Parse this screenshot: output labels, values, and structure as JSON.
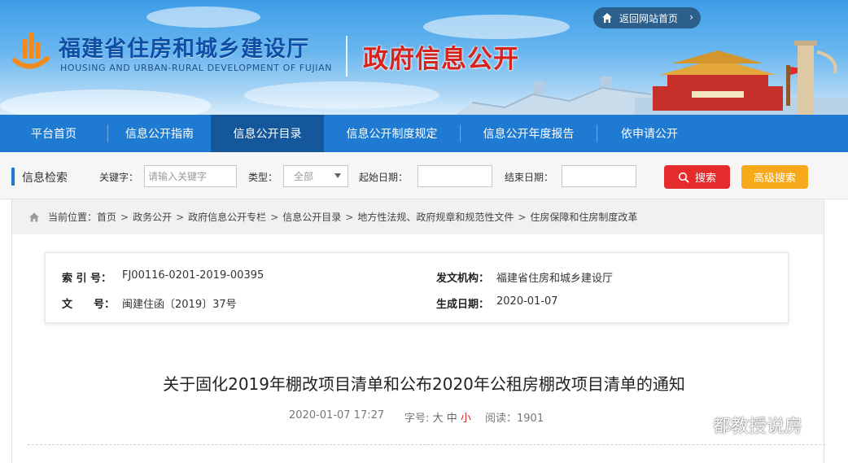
{
  "header": {
    "site_title": "福建省住房和城乡建设厅",
    "site_subtitle": "HOUSING AND URBAN-RURAL DEVELOPMENT OF FUJIAN",
    "section_title": "政府信息公开",
    "back_home_label": "返回网站首页"
  },
  "nav": {
    "items": [
      {
        "label": "平台首页"
      },
      {
        "label": "信息公开指南"
      },
      {
        "label": "信息公开目录"
      },
      {
        "label": "信息公开制度规定"
      },
      {
        "label": "信息公开年度报告"
      },
      {
        "label": "依申请公开"
      }
    ],
    "active_index": 2
  },
  "search": {
    "title": "信息检索",
    "keyword_label": "关键字：",
    "keyword_placeholder": "请输入关键字",
    "type_label": "类型：",
    "type_value": "全部",
    "start_label": "起始日期：",
    "end_label": "结束日期：",
    "search_label": "搜索",
    "advanced_label": "高级搜索"
  },
  "breadcrumb": {
    "prefix": "当前位置：",
    "items": [
      "首页",
      "政务公开",
      "政府信息公开专栏",
      "信息公开目录",
      "地方性法规、政府规章和规范性文件",
      "住房保障和住房制度改革"
    ],
    "separator": ">"
  },
  "meta": {
    "index_key": "索 引 号：",
    "index_value": "FJ00116-0201-2019-00395",
    "issuer_key": "发文机构：",
    "issuer_value": "福建省住房和城乡建设厅",
    "docno_key": "文　　号：",
    "docno_value": "闽建住函〔2019〕37号",
    "date_key": "生成日期：",
    "date_value": "2020-01-07"
  },
  "document": {
    "title": "关于固化2019年棚改项目清单和公布2020年公租房棚改项目清单的通知",
    "datetime": "2020-01-07 17:27",
    "font_label": "字号:",
    "font_large": "大",
    "font_medium": "中",
    "font_small": "小",
    "views_label": "阅读：",
    "views": "1901"
  },
  "watermark": {
    "text": "都教授说房"
  },
  "colors": {
    "nav_bg": "#1f7bd1",
    "nav_active": "#14579b",
    "search_button": "#e52c2c",
    "advanced_button": "#f7a91b",
    "section_title": "#d6231c"
  }
}
